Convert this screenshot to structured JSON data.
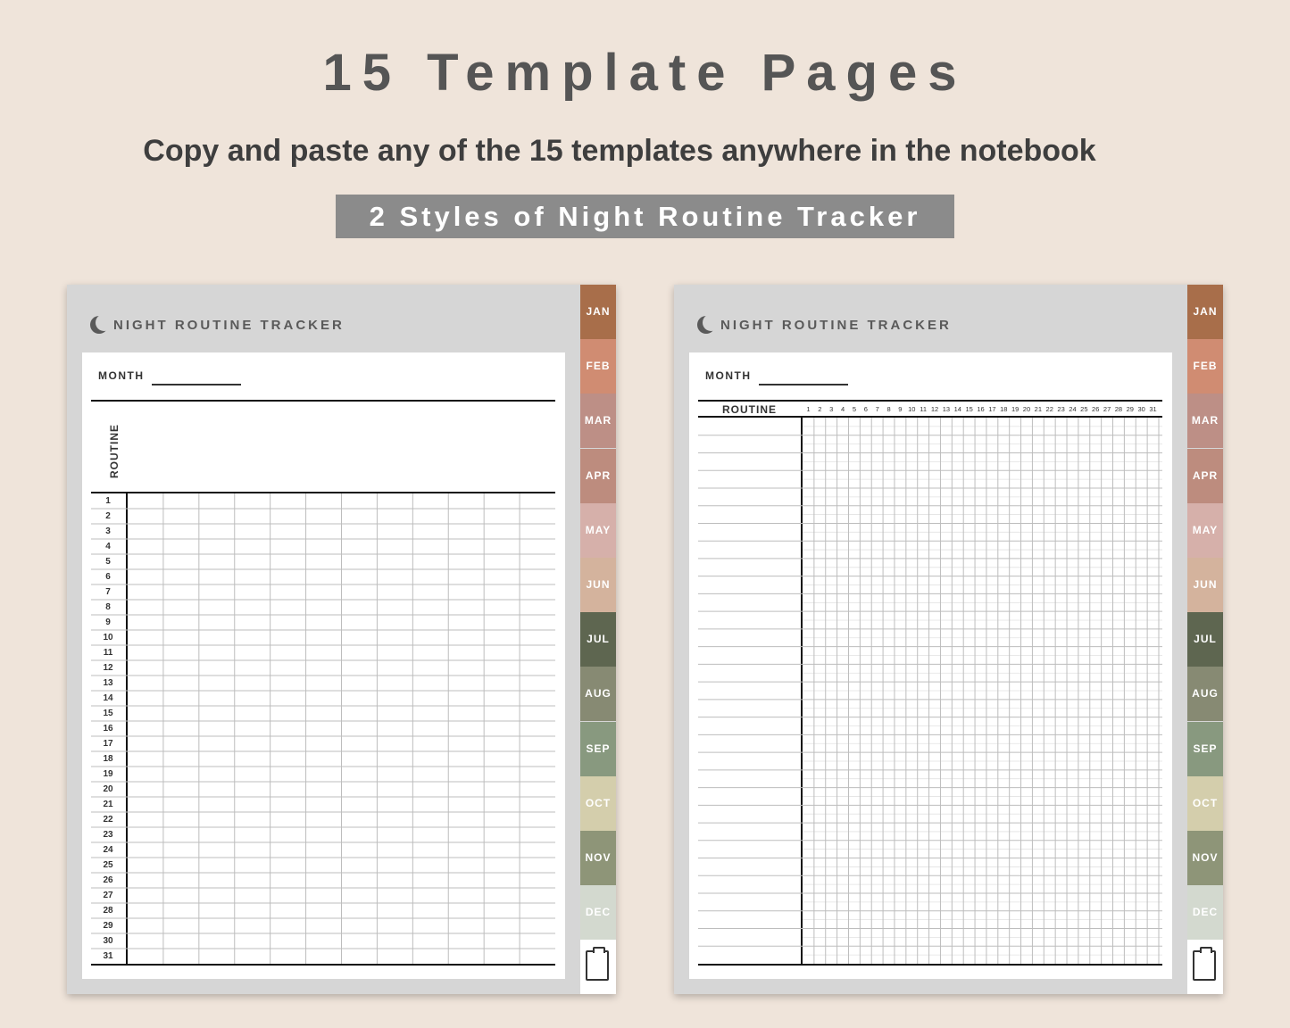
{
  "header": {
    "title": "15 Template Pages",
    "subtitle": "Copy and paste any of the 15 templates anywhere in the notebook",
    "banner": "2 Styles of Night Routine Tracker"
  },
  "page": {
    "title": "NIGHT ROUTINE TRACKER",
    "month_label": "MONTH",
    "routine_label": "ROUTINE"
  },
  "tabs": [
    {
      "label": "JAN",
      "color": "#a86e4a"
    },
    {
      "label": "FEB",
      "color": "#d08c72"
    },
    {
      "label": "MAR",
      "color": "#bd8f86"
    },
    {
      "label": "APR",
      "color": "#bd8c7e"
    },
    {
      "label": "MAY",
      "color": "#d6b0aa"
    },
    {
      "label": "JUN",
      "color": "#d4b39d"
    },
    {
      "label": "JUL",
      "color": "#5e6650"
    },
    {
      "label": "AUG",
      "color": "#878a73"
    },
    {
      "label": "SEP",
      "color": "#88997f"
    },
    {
      "label": "OCT",
      "color": "#d4ceac"
    },
    {
      "label": "NOV",
      "color": "#8e9578"
    },
    {
      "label": "DEC",
      "color": "#d3d9cf"
    }
  ],
  "days": [
    "1",
    "2",
    "3",
    "4",
    "5",
    "6",
    "7",
    "8",
    "9",
    "10",
    "11",
    "12",
    "13",
    "14",
    "15",
    "16",
    "17",
    "18",
    "19",
    "20",
    "21",
    "22",
    "23",
    "24",
    "25",
    "26",
    "27",
    "28",
    "29",
    "30",
    "31"
  ]
}
